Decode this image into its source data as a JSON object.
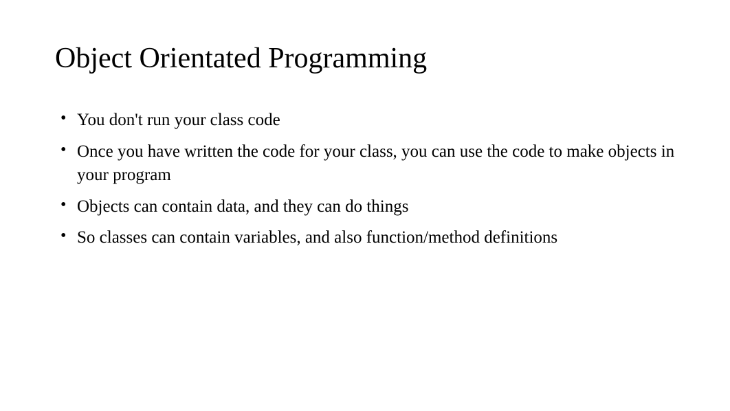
{
  "slide": {
    "title": "Object Orientated Programming",
    "bullets": [
      "You don't run your class code",
      "Once you have written the code for your class, you can use the code to make objects in your program",
      "Objects can contain data, and they can do things",
      "So classes can contain variables, and also function/method definitions"
    ]
  }
}
